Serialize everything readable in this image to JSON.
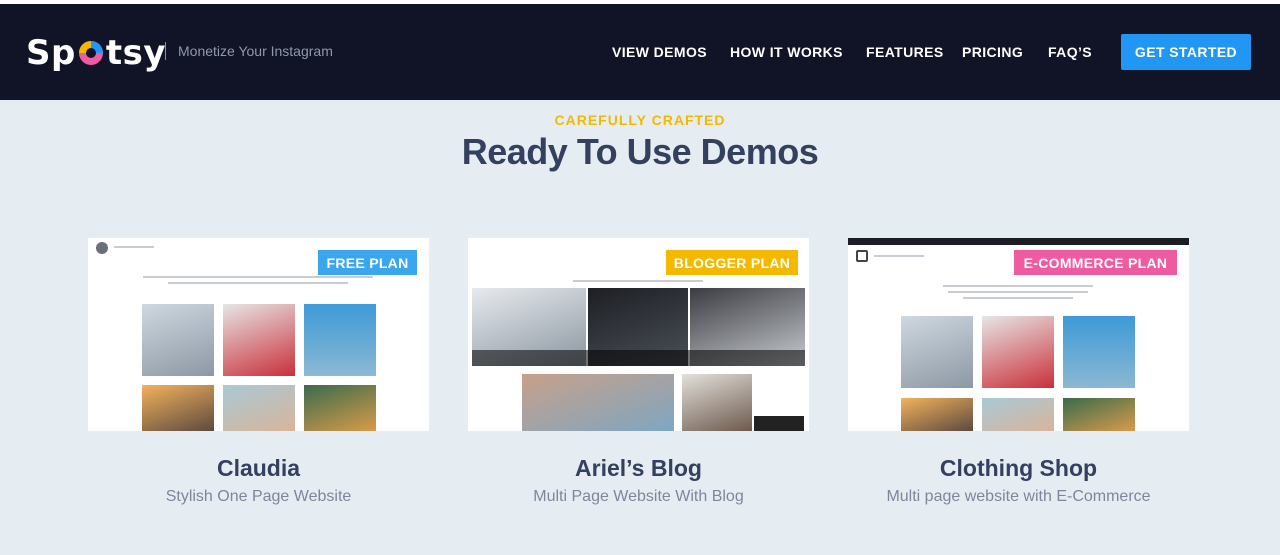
{
  "header": {
    "logo_text_left": "Sp",
    "logo_text_right": "tsy",
    "tagline": "Monetize Your Instagram",
    "nav": [
      {
        "label": "VIEW DEMOS"
      },
      {
        "label": "HOW IT WORKS"
      },
      {
        "label": "FEATURES"
      },
      {
        "label": "PRICING"
      },
      {
        "label": "FAQ’S"
      }
    ],
    "cta_label": "GET STARTED"
  },
  "section": {
    "eyebrow": "CAREFULLY CRAFTED",
    "title": "Ready To Use Demos"
  },
  "demos": [
    {
      "badge": "FREE PLAN",
      "badge_color": "#3aa6ee",
      "title": "Claudia",
      "subtitle": "Stylish One Page Website"
    },
    {
      "badge": "BLOGGER PLAN",
      "badge_color": "#f5b800",
      "title": "Ariel’s Blog",
      "subtitle": "Multi Page Website With Blog"
    },
    {
      "badge": "E-COMMERCE PLAN",
      "badge_color": "#ef5ba1",
      "title": "Clothing Shop",
      "subtitle": "Multi page website with E-Commerce"
    }
  ],
  "colors": {
    "header_bg": "#111326",
    "accent_blue": "#2196f3",
    "eyebrow_yellow": "#f5b800",
    "title_navy": "#33405f"
  }
}
